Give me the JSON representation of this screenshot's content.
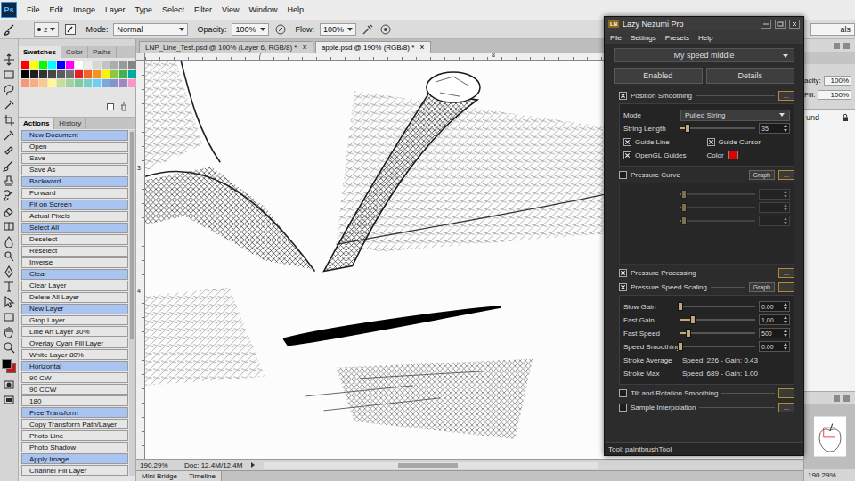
{
  "app": {
    "logo": "Ps"
  },
  "menu": [
    "File",
    "Edit",
    "Image",
    "Layer",
    "Type",
    "Select",
    "Filter",
    "View",
    "Window",
    "Help"
  ],
  "options": {
    "brush_size": "2",
    "mode_label": "Mode:",
    "mode": "Normal",
    "opacity_label": "Opacity:",
    "opacity": "100%",
    "flow_label": "Flow:",
    "flow": "100%",
    "workspace": "als"
  },
  "tools": {
    "foreground": "#000000",
    "background": "#d01414"
  },
  "swatches_panel": {
    "tabs": [
      {
        "label": "Swatches",
        "selected": true
      },
      {
        "label": "Color",
        "selected": false
      },
      {
        "label": "Paths",
        "selected": false
      }
    ],
    "colors": [
      "#ff0000",
      "#ffff00",
      "#00ff00",
      "#00ffff",
      "#0000ff",
      "#ff00ff",
      "#ffffff",
      "#ebebeb",
      "#d6d6d6",
      "#c2c2c2",
      "#adadad",
      "#999999",
      "#858585",
      "#000000",
      "#1f1f1f",
      "#333333",
      "#474747",
      "#5c5c5c",
      "#707070",
      "#ed1c24",
      "#f26522",
      "#f7941d",
      "#fff200",
      "#8dc63f",
      "#39b54a",
      "#00a99d",
      "#f7977a",
      "#f9ad81",
      "#fdc68a",
      "#fff79a",
      "#c4df9b",
      "#a3d39c",
      "#82ca9d",
      "#7bcdc8",
      "#6ecff6",
      "#7ea7d8",
      "#8493ca",
      "#a187be",
      "#f49ac2"
    ]
  },
  "actions_panel": {
    "tabs": [
      {
        "label": "Actions",
        "selected": true
      },
      {
        "label": "History",
        "selected": false
      }
    ],
    "items": [
      {
        "label": "New Document",
        "color": "#a9c4f0"
      },
      {
        "label": "Open",
        "color": "#e6e6e6"
      },
      {
        "label": "Save",
        "color": "#e6e6e6"
      },
      {
        "label": "Save As",
        "color": "#e6e6e6"
      },
      {
        "label": "Backward",
        "color": "#a9c4f0"
      },
      {
        "label": "Forward",
        "color": "#e6e6e6"
      },
      {
        "label": "Fit on Screen",
        "color": "#a9c4f0"
      },
      {
        "label": "Actual Pixels",
        "color": "#e6e6e6"
      },
      {
        "label": "Select All",
        "color": "#a9c4f0"
      },
      {
        "label": "Deselect",
        "color": "#e6e6e6"
      },
      {
        "label": "Reselect",
        "color": "#e6e6e6"
      },
      {
        "label": "Inverse",
        "color": "#e6e6e6"
      },
      {
        "label": "Clear",
        "color": "#a9c4f0"
      },
      {
        "label": "Clear Layer",
        "color": "#e6e6e6"
      },
      {
        "label": "Delete All Layer",
        "color": "#e6e6e6"
      },
      {
        "label": "New Layer",
        "color": "#a9c4f0"
      },
      {
        "label": "Grop Layer",
        "color": "#e6e6e6"
      },
      {
        "label": "Line Art Layer 30%",
        "color": "#e6e6e6"
      },
      {
        "label": "Overlay Cyan Fill Layer",
        "color": "#e6e6e6"
      },
      {
        "label": "White Layer 80%",
        "color": "#e6e6e6"
      },
      {
        "label": "Horizontal",
        "color": "#a9c4f0"
      },
      {
        "label": "90 CW",
        "color": "#e6e6e6"
      },
      {
        "label": "90 CCW",
        "color": "#e6e6e6"
      },
      {
        "label": "180",
        "color": "#e6e6e6"
      },
      {
        "label": "Free Transform",
        "color": "#a9c4f0"
      },
      {
        "label": "Copy Transform Path/Layer",
        "color": "#e6e6e6"
      },
      {
        "label": "Photo Line",
        "color": "#e6e6e6"
      },
      {
        "label": "Photo Shadow",
        "color": "#e6e6e6"
      },
      {
        "label": "Apply Image",
        "color": "#a9c4f0"
      },
      {
        "label": "Channel Fill Layer",
        "color": "#e6e6e6"
      }
    ]
  },
  "document": {
    "tabs": [
      {
        "label": "LNP_Line_Test.psd @ 100% (Layer 6, RGB/8) *",
        "close": "×",
        "selected": false
      },
      {
        "label": "apple.psd @ 190% (RGB/8) *",
        "close": "×",
        "selected": true
      }
    ],
    "ruler_top": [
      "7",
      "8"
    ],
    "ruler_left": [
      "3",
      "4"
    ],
    "zoom": "190.29%",
    "doc_info": "Doc: 12.4M/12.4M",
    "bottom_tabs": [
      "Mini Bridge",
      "Timeline"
    ]
  },
  "layers_panel": {
    "opacity_label": "acity:",
    "opacity": "100%",
    "fill_label": "Fill:",
    "fill": "100%",
    "layer_name": "und",
    "zoom": "190.29%"
  },
  "lnp": {
    "title": "Lazy Nezumi Pro",
    "logo": "LN",
    "menu": [
      "File",
      "Settings",
      "Presets",
      "Help"
    ],
    "preset": "My speed middle",
    "buttons": [
      "Enabled",
      "Details"
    ],
    "sections": [
      {
        "label": "Position Smoothing",
        "checked": true,
        "more": "...",
        "panel": {
          "disabled": false,
          "rows": [
            {
              "kind": "select",
              "label": "Mode",
              "value": "Pulled String"
            },
            {
              "kind": "slider",
              "label": "String Length",
              "level": 0.1,
              "value": "35"
            },
            {
              "kind": "checks",
              "items": [
                {
                  "kind": "check",
                  "label": "Guide Line",
                  "checked": true
                },
                {
                  "kind": "check",
                  "label": "Guide Cursor",
                  "checked": true
                }
              ]
            },
            {
              "kind": "checks",
              "items": [
                {
                  "kind": "check",
                  "label": "OpenGL Guides",
                  "checked": true
                },
                {
                  "kind": "color",
                  "label": "Color",
                  "color": "#e00000"
                }
              ]
            }
          ]
        }
      },
      {
        "label": "Pressure Curve",
        "checked": false,
        "graph": "Graph",
        "more": "...",
        "panel": {
          "disabled": true,
          "rows": [
            {
              "kind": "slider",
              "level": 0.05
            },
            {
              "kind": "slider",
              "level": 0.05
            },
            {
              "kind": "slider",
              "level": 0.05
            }
          ]
        }
      },
      {
        "label": "Pressure Processing",
        "checked": true,
        "more": "..."
      },
      {
        "label": "Pressure Speed Scaling",
        "checked": true,
        "graph": "Graph",
        "more": "...",
        "panel": {
          "disabled": false,
          "rows": [
            {
              "kind": "slider",
              "label": "Slow Gain",
              "level": 0.0,
              "value": "0.00"
            },
            {
              "kind": "slider",
              "label": "Fast Gain",
              "level": 0.17,
              "value": "1,00"
            },
            {
              "kind": "slider",
              "label": "Fast Speed",
              "level": 0.11,
              "value": "500"
            },
            {
              "kind": "slider",
              "label": "Speed Smoothing",
              "level": 0.0,
              "value": "0.00"
            },
            {
              "kind": "stat",
              "label": "Stroke Average",
              "value": "Speed: 226 - Gain: 0.43"
            },
            {
              "kind": "stat",
              "label": "Stroke Max",
              "value": "Speed: 689 - Gain: 1.00"
            }
          ]
        }
      },
      {
        "label": "Tilt and Rotation Smoothing",
        "checked": false,
        "more": "..."
      },
      {
        "label": "Sample Interpolation",
        "checked": false,
        "more": "..."
      }
    ],
    "footer": "Tool: paintbrushTool"
  }
}
